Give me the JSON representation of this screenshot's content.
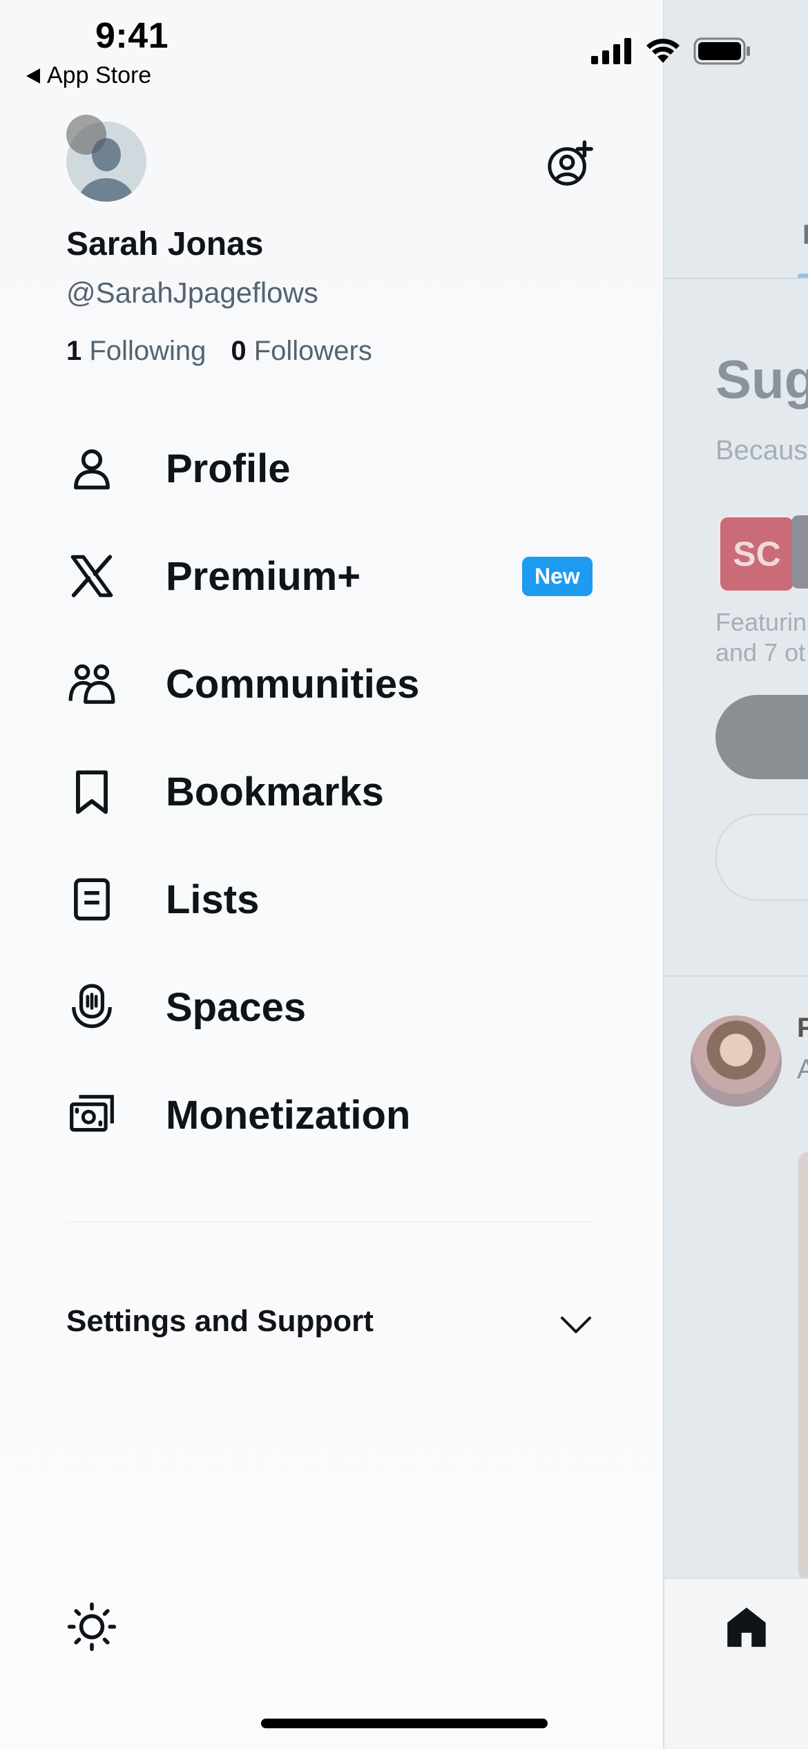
{
  "status_bar": {
    "time": "9:41",
    "back_label": "App Store"
  },
  "profile": {
    "name": "Sarah Jonas",
    "handle": "@SarahJpageflows",
    "following_count": "1",
    "following_label": "Following",
    "followers_count": "0",
    "followers_label": "Followers"
  },
  "menu": {
    "items": [
      {
        "label": "Profile",
        "icon": "person-icon"
      },
      {
        "label": "Premium+",
        "icon": "x-logo-icon",
        "badge": "New"
      },
      {
        "label": "Communities",
        "icon": "communities-icon"
      },
      {
        "label": "Bookmarks",
        "icon": "bookmark-icon"
      },
      {
        "label": "Lists",
        "icon": "list-icon"
      },
      {
        "label": "Spaces",
        "icon": "spaces-icon"
      },
      {
        "label": "Monetization",
        "icon": "money-icon"
      }
    ]
  },
  "settings": {
    "label": "Settings and Support"
  },
  "background": {
    "tab_char": "I",
    "suggested_title": "Sug",
    "because_text": "Becaus",
    "logo_text": "SC",
    "featuring_line1": "Featurin",
    "featuring_line2": "and 7 ot",
    "post_name": "F",
    "post_handle": "A"
  },
  "colors": {
    "accent": "#1d9bf0",
    "text": "#0f1419",
    "secondary": "#536471"
  }
}
